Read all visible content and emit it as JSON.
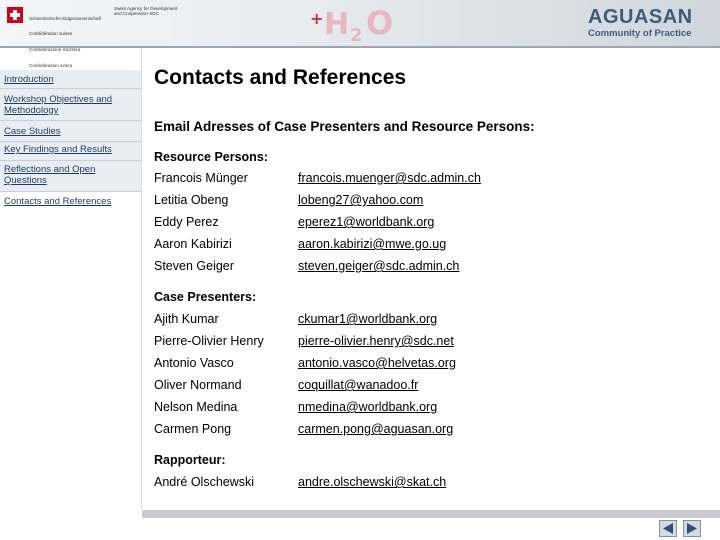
{
  "header": {
    "confederation_lines": [
      "Schweizerische Eidgenossenschaft",
      "Confédération suisse",
      "Confederazione Svizzera",
      "Confederaziun svizra"
    ],
    "agency_lines": [
      "Swiss Agency for Development",
      "and Cooperation SDC"
    ],
    "h2o_logo": {
      "plus": "+",
      "h": "H",
      "two": "2",
      "o": "O"
    },
    "aguasan": {
      "title": "AGUASAN",
      "subtitle": "Community of Practice"
    },
    "brand_color": "#3f5b7a"
  },
  "sidebar": {
    "items": [
      {
        "label": "Introduction"
      },
      {
        "label": "Workshop Objectives and Methodology"
      },
      {
        "label": "Case Studies"
      },
      {
        "label": "Key Findings and Results"
      },
      {
        "label": "Reflections and Open Questions"
      },
      {
        "label": "Contacts and References"
      }
    ]
  },
  "main": {
    "title": "Contacts and References",
    "section_heading": "Email Adresses of Case Presenters and Resource Persons:",
    "groups": [
      {
        "heading": "Resource Persons:",
        "people": [
          {
            "name": "Francois Münger",
            "email": "francois.muenger@sdc.admin.ch"
          },
          {
            "name": "Letitia Obeng",
            "email": "lobeng27@yahoo.com"
          },
          {
            "name": "Eddy Perez",
            "email": "eperez1@worldbank.org"
          },
          {
            "name": "Aaron Kabirizi",
            "email": "aaron.kabirizi@mwe.go.ug"
          },
          {
            "name": "Steven Geiger",
            "email": "steven.geiger@sdc.admin.ch"
          }
        ]
      },
      {
        "heading": "Case Presenters:",
        "people": [
          {
            "name": "Ajith Kumar",
            "email": "ckumar1@worldbank.org"
          },
          {
            "name": "Pierre-Olivier Henry",
            "email": "pierre-olivier.henry@sdc.net"
          },
          {
            "name": "Antonio Vasco",
            "email": "antonio.vasco@helvetas.org"
          },
          {
            "name": "Oliver Normand",
            "email": "coquillat@wanadoo.fr"
          },
          {
            "name": "Nelson Medina",
            "email": "nmedina@worldbank.org"
          },
          {
            "name": "Carmen Pong",
            "email": "carmen.pong@aguasan.org"
          }
        ]
      },
      {
        "heading": "Rapporteur:",
        "people": [
          {
            "name": "André Olschewski",
            "email": "andre.olschewski@skat.ch"
          }
        ]
      }
    ]
  },
  "footer": {
    "prev_icon": "arrow-left-icon",
    "next_icon": "arrow-right-icon"
  }
}
